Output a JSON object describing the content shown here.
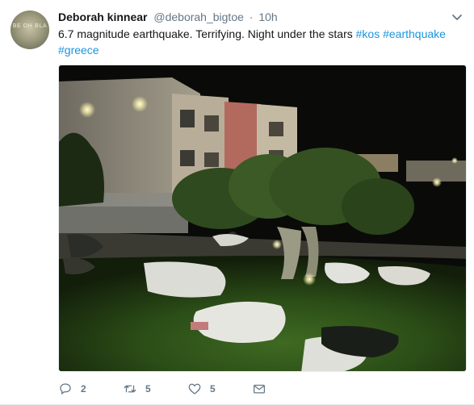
{
  "tweet": {
    "display_name": "Deborah kinnear",
    "handle": "@deborah_bigtoe",
    "separator": "·",
    "time": "10h",
    "text": "6.7 magnitude earthquake. Terrifying. Night under the stars",
    "hashtags": [
      "#kos",
      "#earthquake",
      "#greece"
    ],
    "avatar_text": "BE OH BLA"
  },
  "actions": {
    "reply_count": "2",
    "retweet_count": "5",
    "like_count": "5"
  },
  "icons": {
    "reply": "reply-icon",
    "retweet": "retweet-icon",
    "like": "heart-icon",
    "message": "envelope-icon",
    "menu": "chevron-down-icon"
  },
  "colors": {
    "link": "#1b95e0",
    "muted": "#657786",
    "text": "#14171a"
  }
}
